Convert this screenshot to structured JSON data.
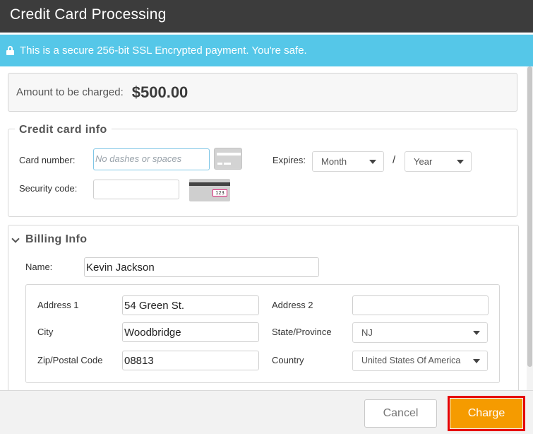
{
  "window": {
    "title": "Credit Card Processing"
  },
  "secure_notice": {
    "text": "This is a secure 256-bit SSL Encrypted payment. You're safe.",
    "icon": "lock-icon"
  },
  "amount": {
    "label": "Amount to be charged:",
    "value": "$500.00"
  },
  "credit_card": {
    "legend": "Credit card info",
    "card_number_label": "Card number:",
    "card_number_placeholder": "No dashes or spaces",
    "card_number_value": "",
    "expires_label": "Expires:",
    "month_value": "Month",
    "separator": "/",
    "year_value": "Year",
    "security_code_label": "Security code:",
    "security_code_value": "",
    "cvv_sample": "123"
  },
  "billing": {
    "legend": "Billing Info",
    "name_label": "Name:",
    "name_value": "Kevin Jackson",
    "address1_label": "Address 1",
    "address1_value": "54 Green St.",
    "address2_label": "Address 2",
    "address2_value": "",
    "city_label": "City",
    "city_value": "Woodbridge",
    "state_label": "State/Province",
    "state_value": "NJ",
    "zip_label": "Zip/Postal Code",
    "zip_value": "08813",
    "country_label": "Country",
    "country_value": "United States Of America"
  },
  "footer": {
    "cancel_label": "Cancel",
    "charge_label": "Charge"
  },
  "colors": {
    "titlebar": "#3c3c3c",
    "notice": "#55c7e8",
    "charge": "#f59b00",
    "highlight": "#e60000"
  }
}
